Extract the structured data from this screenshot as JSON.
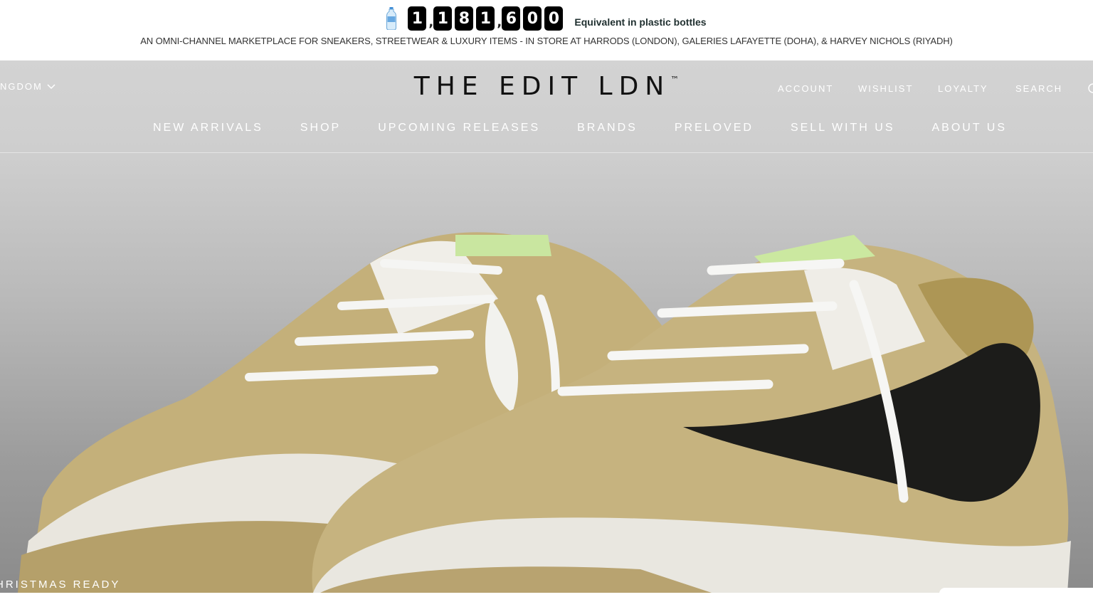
{
  "banner": {
    "counter_digits": [
      "1",
      "1",
      "8",
      "1",
      "6",
      "0",
      "0"
    ],
    "counter_caption": "Equivalent in plastic bottles",
    "tagline": "AN OMNI-CHANNEL MARKETPLACE FOR SNEAKERS, STREETWEAR & LUXURY ITEMS - IN STORE AT HARRODS (LONDON), GALERIES LAFAYETTE (DOHA), & HARVEY NICHOLS (RIYADH)"
  },
  "header": {
    "country": "NGDOM",
    "logo": "THE EDIT LDN",
    "logo_mark": "™",
    "account_links": [
      "ACCOUNT",
      "WISHLIST",
      "LOYALTY",
      "SEARCH"
    ],
    "cart_icon": "cart-icon"
  },
  "nav": {
    "items": [
      "NEW ARRIVALS",
      "SHOP",
      "UPCOMING RELEASES",
      "BRANDS",
      "PRELOVED",
      "SELL WITH US",
      "ABOUT US"
    ]
  },
  "hero": {
    "promo": "HRISTMAS READY",
    "image": "sneaker-pair-image"
  },
  "colors": {
    "digit_bg": "#000000",
    "caption": "#1f2f2f",
    "header_text": "#ffffff",
    "logo": "#111111"
  }
}
